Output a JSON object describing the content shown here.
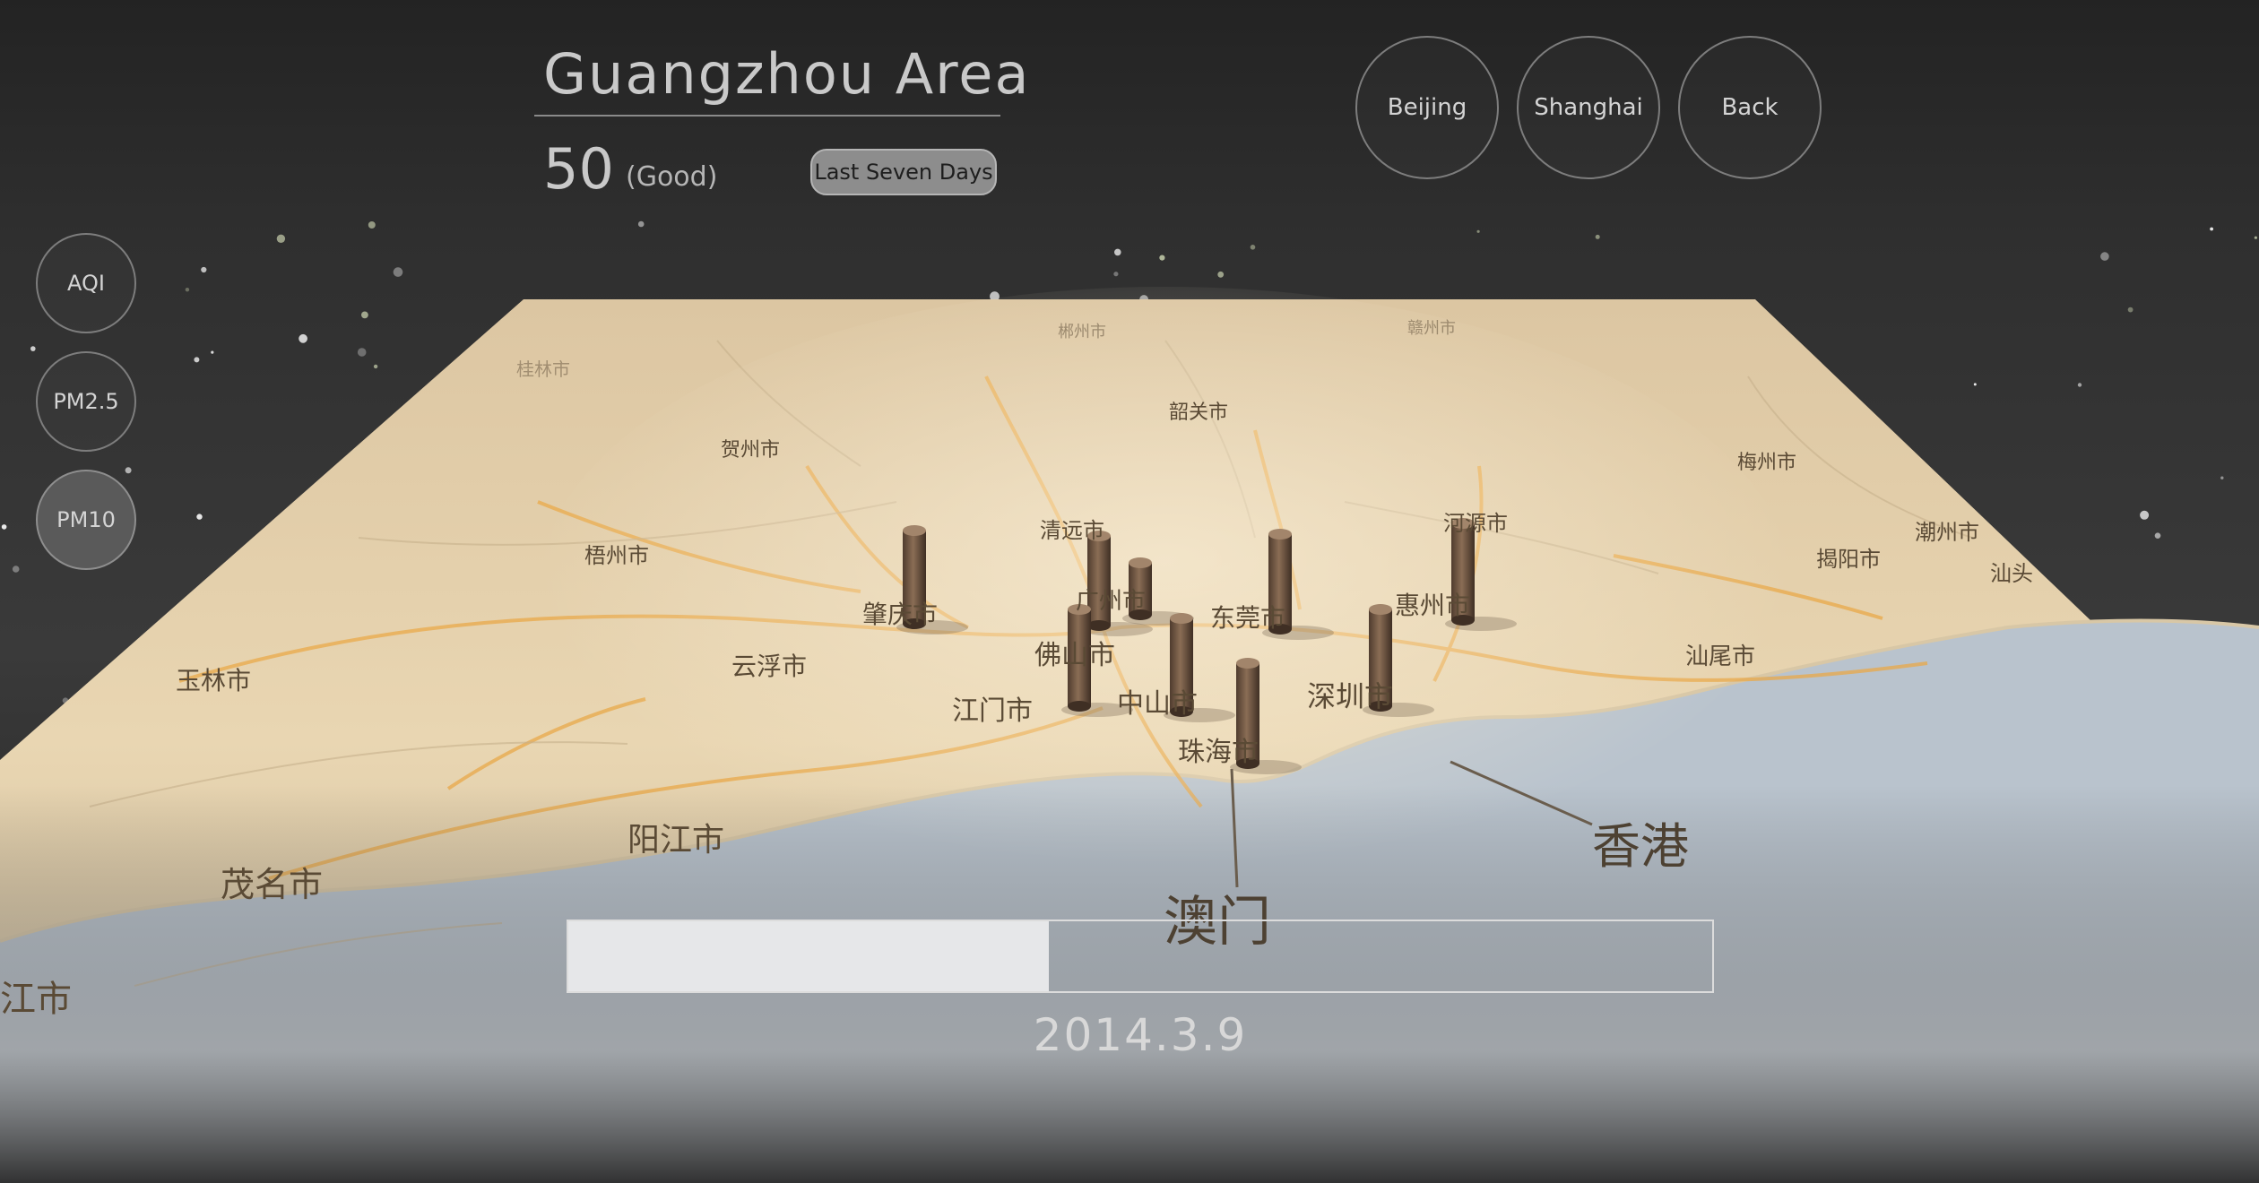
{
  "header": {
    "area_title": "Guangzhou Area",
    "aqi_value": "50",
    "aqi_level": "(Good)",
    "range_button": "Last Seven Days"
  },
  "nav": {
    "beijing": "Beijing",
    "shanghai": "Shanghai",
    "back": "Back"
  },
  "metrics": {
    "aqi": "AQI",
    "pm25": "PM2.5",
    "pm10": "PM10",
    "active": "PM10"
  },
  "timeline": {
    "date": "2014.3.9",
    "progress_fraction": 0.42
  },
  "map": {
    "labels": {
      "guilin": "桂林市",
      "hezhou": "贺州市",
      "shaoguan": "韶关市",
      "meizhou": "梅州市",
      "wuzhou": "梧州市",
      "qingyuan": "清远市",
      "heyuan": "河源市",
      "chaozhou": "潮州市",
      "jieyang": "揭阳市",
      "shantou": "汕头",
      "zhaoqing": "肇庆市",
      "guangzhou": "广州市",
      "dongguan": "东莞市",
      "huizhou": "惠州市",
      "yulin": "玉林市",
      "yunfu": "云浮市",
      "foshan": "佛山市",
      "shanwei": "汕尾市",
      "jiangmen": "江门市",
      "zhongshan": "中山市",
      "shenzhen": "深圳市",
      "zhuhai": "珠海市",
      "hongkong": "香港",
      "yangjiang": "阳江市",
      "maoming": "茂名市",
      "zhanjiang": "江市",
      "macau": "澳门",
      "chenzhou": "郴州市",
      "ganzhou": "赣州市"
    },
    "colors": {
      "land": "#e6d4b3",
      "sea": "#b9c2cc",
      "roads": "#e8a847",
      "pillar": "#6b5442"
    }
  }
}
